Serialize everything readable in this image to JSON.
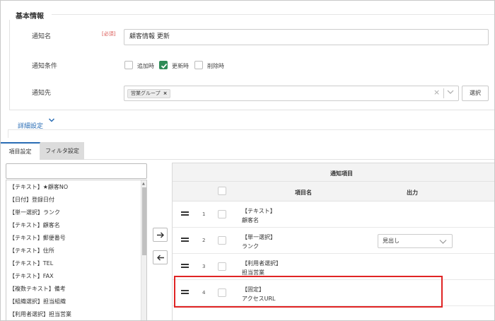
{
  "basic_section": {
    "title": "基本情報",
    "name_label": "通知名",
    "required_badge": "[必須]",
    "name_value": "顧客情報 更新",
    "condition_label": "通知条件",
    "conditions": [
      {
        "label": "追加時",
        "checked": false
      },
      {
        "label": "更新時",
        "checked": true
      },
      {
        "label": "削除時",
        "checked": false
      }
    ],
    "target_label": "通知先",
    "target_tag": "営業グループ",
    "tag_remove": "×",
    "clear_symbol": "×",
    "select_button": "選択"
  },
  "detail_section": {
    "title": "詳細設定"
  },
  "tabs": [
    {
      "label": "項目設定",
      "active": true
    },
    {
      "label": "フィルタ設定",
      "active": false
    }
  ],
  "available_items": [
    "【テキスト】★顧客NO",
    "【日付】登録日付",
    "【単一選択】ランク",
    "【テキスト】顧客名",
    "【テキスト】郵便番号",
    "【テキスト】住所",
    "【テキスト】TEL",
    "【テキスト】FAX",
    "【複数テキスト】備考",
    "【組織選択】担当組織",
    "【利用者選択】担当営業"
  ],
  "notify_table": {
    "title": "通知項目",
    "col_item": "項目名",
    "col_output": "出力",
    "rows": [
      {
        "num": "1",
        "type": "【テキスト】",
        "name": "顧客名",
        "output": ""
      },
      {
        "num": "2",
        "type": "【単一選択】",
        "name": "ランク",
        "output": "見出し"
      },
      {
        "num": "3",
        "type": "【利用者選択】",
        "name": "担当営業",
        "output": ""
      },
      {
        "num": "4",
        "type": "【固定】",
        "name": "アクセスURL",
        "output": ""
      }
    ]
  },
  "colors": {
    "accent": "#2a6db5",
    "checked": "#2e8b57",
    "highlight": "#e02424",
    "required": "#d9534f"
  }
}
